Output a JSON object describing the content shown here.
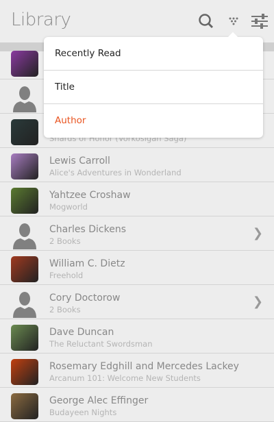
{
  "header": {
    "title": "Library",
    "icons": [
      "search-icon",
      "sort-icon",
      "settings-icon"
    ]
  },
  "sort_menu": {
    "options": [
      "Recently Read",
      "Title",
      "Author"
    ],
    "selected": "Author",
    "accent": "#e95420"
  },
  "list": [
    {
      "type": "cover",
      "color": "#8a3aa0",
      "name": "",
      "sub": ""
    },
    {
      "type": "person",
      "name": "",
      "sub": ""
    },
    {
      "type": "cover",
      "color": "#2a3a3a",
      "name": "",
      "sub": "Shards of Honor (Vorkosigan Saga)"
    },
    {
      "type": "cover",
      "color": "#a77cc0",
      "name": "Lewis Carroll",
      "sub": "Alice's Adventures in Wonderland"
    },
    {
      "type": "cover",
      "color": "#5a7a30",
      "name": "Yahtzee Croshaw",
      "sub": "Mogworld"
    },
    {
      "type": "person",
      "name": "Charles Dickens",
      "sub": "2 Books",
      "chevron": true
    },
    {
      "type": "cover",
      "color": "#a03a20",
      "name": "William C. Dietz",
      "sub": "Freehold"
    },
    {
      "type": "person",
      "name": "Cory Doctorow",
      "sub": "2 Books",
      "chevron": true
    },
    {
      "type": "cover",
      "color": "#6a8a50",
      "name": "Dave Duncan",
      "sub": "The Reluctant Swordsman"
    },
    {
      "type": "cover",
      "color": "#c04010",
      "name": "Rosemary Edghill and Mercedes Lackey",
      "sub": "Arcanum 101: Welcome New Students"
    },
    {
      "type": "cover",
      "color": "#8a6a40",
      "name": "George Alec Effinger",
      "sub": "Budayeen Nights"
    }
  ]
}
